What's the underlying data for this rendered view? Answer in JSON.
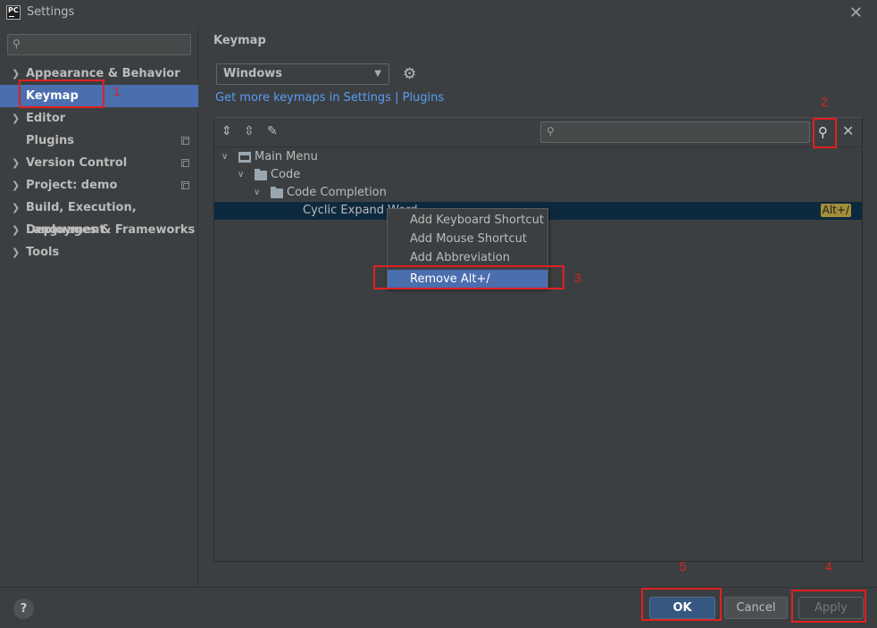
{
  "window": {
    "title": "Settings",
    "logo_text": "PC"
  },
  "sidebar": {
    "items": [
      {
        "label": "Appearance & Behavior",
        "expandable": true
      },
      {
        "label": "Keymap",
        "selected": true
      },
      {
        "label": "Editor",
        "expandable": true
      },
      {
        "label": "Plugins",
        "copy_icon": true
      },
      {
        "label": "Version Control",
        "expandable": true,
        "copy_icon": true
      },
      {
        "label": "Project: demo",
        "expandable": true,
        "copy_icon": true
      },
      {
        "label": "Build, Execution, Deployment",
        "expandable": true
      },
      {
        "label": "Languages & Frameworks",
        "expandable": true
      },
      {
        "label": "Tools",
        "expandable": true
      }
    ]
  },
  "main": {
    "title": "Keymap",
    "keymap_select": "Windows",
    "link": "Get more keymaps in Settings | Plugins",
    "tree": {
      "nodes": [
        {
          "label": "Main Menu",
          "icon": "menu-icon"
        },
        {
          "label": "Code",
          "icon": "folder-icon"
        },
        {
          "label": "Code Completion",
          "icon": "folder-icon"
        },
        {
          "label": "Cyclic Expand Word",
          "shortcut": "Alt+/"
        }
      ]
    },
    "context_menu": {
      "items": [
        "Add Keyboard Shortcut",
        "Add Mouse Shortcut",
        "Add Abbreviation",
        "Remove Alt+/"
      ]
    }
  },
  "footer": {
    "help": "?",
    "ok": "OK",
    "cancel": "Cancel",
    "apply": "Apply"
  },
  "annotations": [
    "1",
    "2",
    "3",
    "4",
    "5"
  ],
  "colors": {
    "background": "#3c3f41",
    "selection": "#4b6eaf",
    "link": "#589df6",
    "annotation": "#e02020",
    "ok_button": "#365880"
  }
}
